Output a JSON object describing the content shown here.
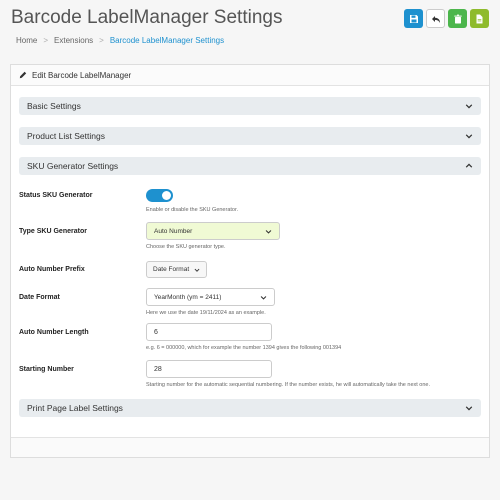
{
  "header": {
    "title": "Barcode LabelManager Settings",
    "actions": [
      {
        "name": "save",
        "icon": "save-icon",
        "color": "#1e91cf"
      },
      {
        "name": "back",
        "icon": "reply-icon",
        "color": "#ffffff"
      },
      {
        "name": "delete",
        "icon": "trash-icon",
        "color": "#4cb64c"
      },
      {
        "name": "copy",
        "icon": "copy-icon",
        "color": "#8fbb2c"
      }
    ]
  },
  "breadcrumb": [
    "Home",
    "Extensions",
    "Barcode LabelManager Settings"
  ],
  "panel": {
    "heading": "Edit Barcode LabelManager"
  },
  "sections": {
    "basic": "Basic Settings",
    "product_list": "Product List Settings",
    "sku_generator": "SKU Generator Settings",
    "print_page": "Print Page Label Settings"
  },
  "fields": {
    "status": {
      "label": "Status SKU Generator",
      "enabled": true,
      "help": "Enable or disable the SKU Generator."
    },
    "type": {
      "label": "Type SKU Generator",
      "value": "Auto Number",
      "help": "Choose the SKU generator type."
    },
    "prefix": {
      "label": "Auto Number Prefix",
      "value": "Date Format"
    },
    "date_format": {
      "label": "Date Format",
      "value": "YearMonth (ym = 2411)",
      "help": "Here we use the date 19/11/2024 as an example."
    },
    "length": {
      "label": "Auto Number Length",
      "value": "6",
      "help": "e.g. 6 = 000000, which for example the number 1394 gives the following 001394"
    },
    "starting": {
      "label": "Starting Number",
      "value": "28",
      "help": "Starting number for the automatic sequential numbering. If the number exists, he will automatically take the next one."
    }
  },
  "colors": {
    "primary": "#1e91cf",
    "accordion_bg": "#e8ecef",
    "highlight_select": "#f0fad4"
  }
}
